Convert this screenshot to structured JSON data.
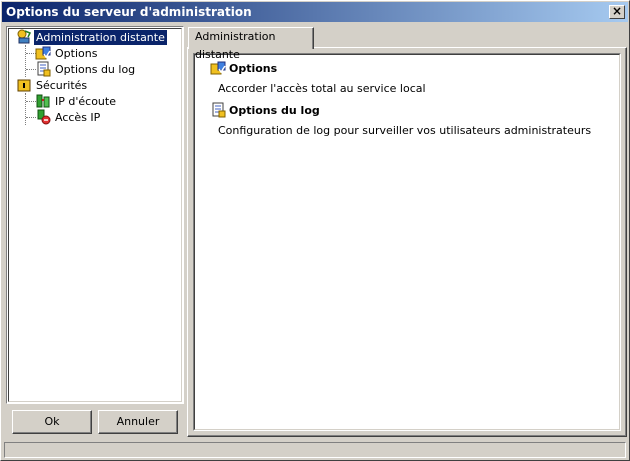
{
  "window": {
    "title": "Options du serveur d'administration",
    "close_glyph": "×"
  },
  "tree": {
    "items": [
      {
        "label": "Administration distante",
        "icon": "admin-remote-icon",
        "selected": true
      },
      {
        "label": "Options",
        "icon": "options-icon"
      },
      {
        "label": "Options du log",
        "icon": "log-options-icon"
      },
      {
        "label": "Sécurités",
        "icon": "security-lock-icon"
      },
      {
        "label": "IP d'écoute",
        "icon": "listen-ip-icon"
      },
      {
        "label": "Accès IP",
        "icon": "ip-access-icon"
      }
    ]
  },
  "buttons": {
    "ok": "Ok",
    "cancel": "Annuler"
  },
  "tabs": [
    {
      "label": "Administration distante"
    }
  ],
  "content": {
    "entries": [
      {
        "title": "Options",
        "description": "Accorder l'accès total au service local",
        "icon": "options-icon"
      },
      {
        "title": "Options du log",
        "description": "Configuration de log pour surveiller vos utilisateurs administrateurs",
        "icon": "log-options-icon"
      }
    ]
  },
  "colors": {
    "selection": "#0a246a",
    "face": "#d4d0c8",
    "title_start": "#0a246a",
    "title_end": "#a6caf0"
  }
}
